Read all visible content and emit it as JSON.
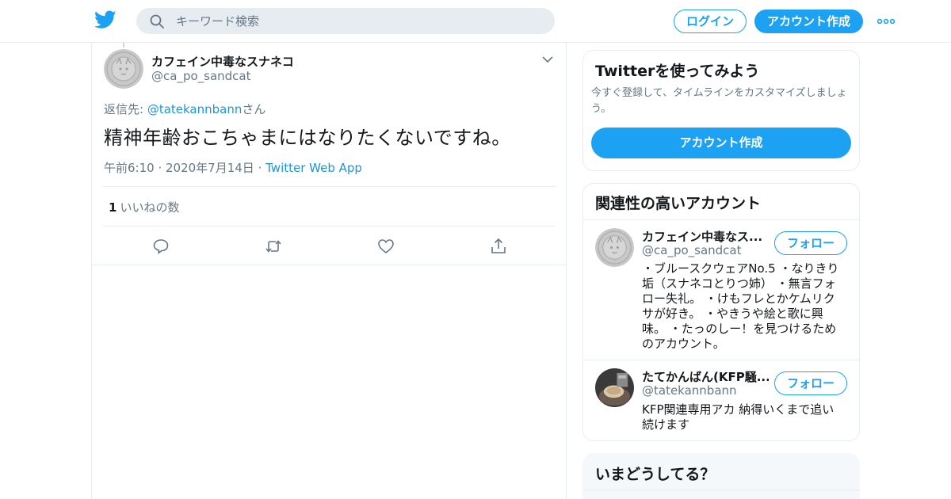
{
  "header": {
    "search_placeholder": "キーワード検索",
    "login_label": "ログイン",
    "signup_label": "アカウント作成",
    "more_icon": "more-dots-icon",
    "brand_color": "#1da1f2"
  },
  "tweet": {
    "display_name": "カフェイン中毒なスナネコ",
    "handle": "@ca_po_sandcat",
    "reply_prefix": "返信先: ",
    "reply_mention": "@tatekannbann",
    "reply_suffix": "さん",
    "text": "精神年齢おこちゃまにはなりたくないですね。",
    "time": "午前6:10",
    "date": "2020年7月14日",
    "source": "Twitter Web App",
    "like_count": "1",
    "like_label": "いいねの数",
    "actions": [
      "reply-icon",
      "retweet-icon",
      "like-icon",
      "share-icon"
    ]
  },
  "signup_card": {
    "title": "Twitterを使ってみよう",
    "description": "今すぐ登録して、タイムラインをカスタマイズしましょう。",
    "button_label": "アカウント作成"
  },
  "related": {
    "title": "関連性の高いアカウント",
    "accounts": [
      {
        "name": "カフェイン中毒なス...",
        "handle": "@ca_po_sandcat",
        "follow_label": "フォロー",
        "bio": "・ブルースクウェアNo.5 ・なりきり垢（スナネコとりつ姉） ・無言フォロー失礼。 ・けもフレとかケムリクサが好き。 ・やきうや絵と歌に興味。 ・たっのしー！を見つけるためのアカウント。"
      },
      {
        "name": "たてかんばん(KFP騒...",
        "handle": "@tatekannbann",
        "follow_label": "フォロー",
        "bio": "KFP関連専用アカ 納得いくまで追い続けます"
      }
    ]
  },
  "whats_happening": {
    "title": "いまどうしてる？"
  }
}
